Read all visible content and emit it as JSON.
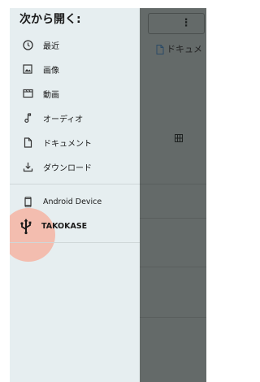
{
  "drawer": {
    "title": "次から開く:",
    "items": [
      {
        "label": "最近",
        "icon": "clock-icon"
      },
      {
        "label": "画像",
        "icon": "image-icon"
      },
      {
        "label": "動画",
        "icon": "video-icon"
      },
      {
        "label": "オーディオ",
        "icon": "music-note-icon"
      },
      {
        "label": "ドキュメント",
        "icon": "document-icon"
      },
      {
        "label": "ダウンロード",
        "icon": "download-icon"
      }
    ],
    "devices": [
      {
        "label": "Android Device",
        "icon": "phone-icon"
      },
      {
        "label": "TAKOKASE",
        "icon": "usb-icon"
      }
    ]
  },
  "background": {
    "breadcrumb": "ドキュメ",
    "menu_glyph": "⋮"
  },
  "colors": {
    "drawer_bg": "#e6eef0",
    "scrim": "#646a69",
    "ripple": "#f4b4a3"
  }
}
